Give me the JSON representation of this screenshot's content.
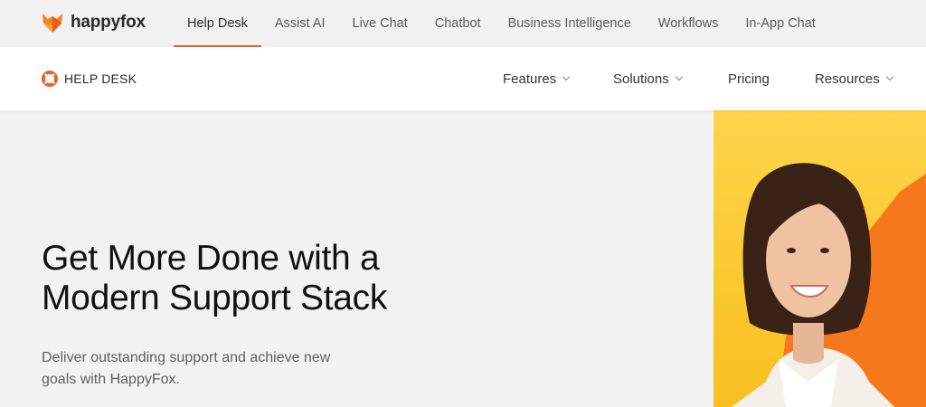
{
  "brand": {
    "name": "happyfox",
    "icon": "fox-logo-icon"
  },
  "products": [
    {
      "label": "Help Desk",
      "active": true
    },
    {
      "label": "Assist AI",
      "active": false
    },
    {
      "label": "Live Chat",
      "active": false
    },
    {
      "label": "Chatbot",
      "active": false
    },
    {
      "label": "Business Intelligence",
      "active": false
    },
    {
      "label": "Workflows",
      "active": false
    },
    {
      "label": "In-App Chat",
      "active": false
    }
  ],
  "section": {
    "label": "HELP DESK",
    "icon": "lifebuoy-icon"
  },
  "nav": [
    {
      "label": "Features",
      "dropdown": true
    },
    {
      "label": "Solutions",
      "dropdown": true
    },
    {
      "label": "Pricing",
      "dropdown": false
    },
    {
      "label": "Resources",
      "dropdown": true
    }
  ],
  "hero": {
    "title_lines": [
      "Get More Done with a",
      "Modern Support Stack"
    ],
    "subtitle_lines": [
      "Deliver outstanding support and achieve new",
      "goals with HappyFox."
    ]
  },
  "colors": {
    "accent": "#e0662b",
    "yellow": "#fccb2e",
    "orange": "#f7771c"
  }
}
